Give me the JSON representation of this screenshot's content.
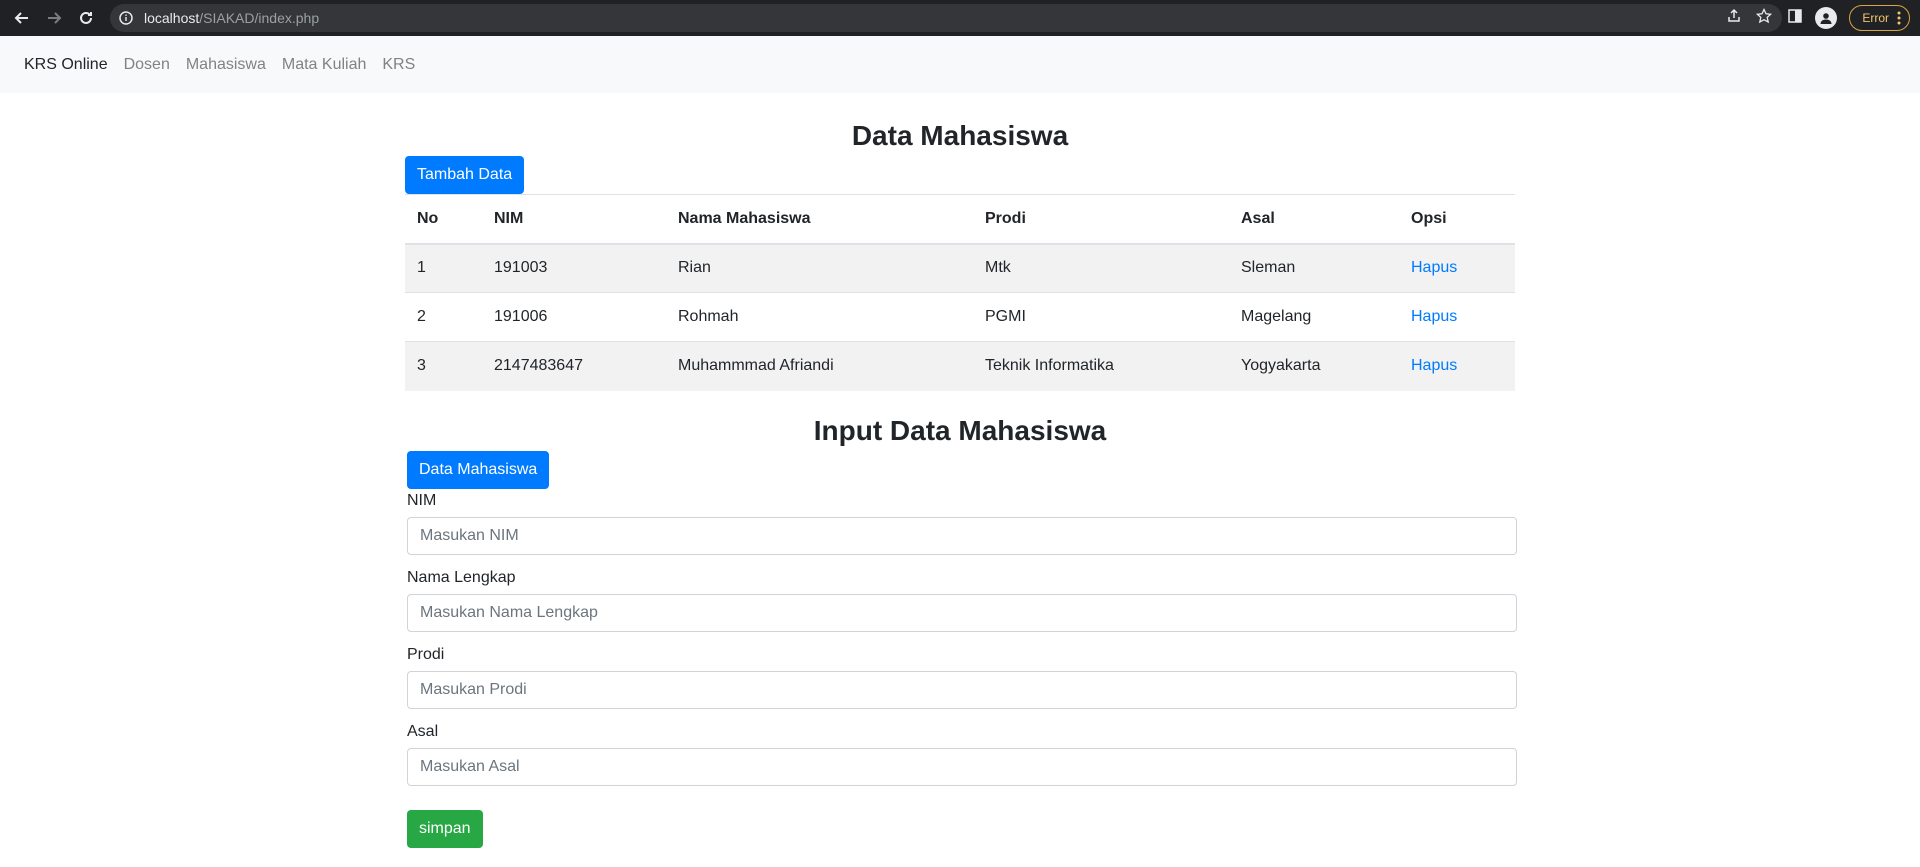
{
  "browser": {
    "url_host": "localhost",
    "url_path": "/SIAKAD/index.php",
    "error_label": "Error"
  },
  "navbar": {
    "brand": "KRS Online",
    "links": [
      "Dosen",
      "Mahasiswa",
      "Mata Kuliah",
      "KRS"
    ]
  },
  "data_section": {
    "title": "Data Mahasiswa",
    "add_button": "Tambah Data",
    "table": {
      "headers": [
        "No",
        "NIM",
        "Nama Mahasiswa",
        "Prodi",
        "Asal",
        "Opsi"
      ],
      "rows": [
        {
          "no": "1",
          "nim": "191003",
          "nama": "Rian",
          "prodi": "Mtk",
          "asal": "Sleman",
          "opsi": "Hapus"
        },
        {
          "no": "2",
          "nim": "191006",
          "nama": "Rohmah",
          "prodi": "PGMI",
          "asal": "Magelang",
          "opsi": "Hapus"
        },
        {
          "no": "3",
          "nim": "2147483647",
          "nama": "Muhammmad Afriandi",
          "prodi": "Teknik Informatika",
          "asal": "Yogyakarta",
          "opsi": "Hapus"
        }
      ]
    }
  },
  "input_section": {
    "title": "Input Data Mahasiswa",
    "data_button": "Data Mahasiswa",
    "fields": [
      {
        "label": "NIM",
        "placeholder": "Masukan NIM"
      },
      {
        "label": "Nama Lengkap",
        "placeholder": "Masukan Nama Lengkap"
      },
      {
        "label": "Prodi",
        "placeholder": "Masukan Prodi"
      },
      {
        "label": "Asal",
        "placeholder": "Masukan Asal"
      }
    ],
    "submit_button": "simpan"
  },
  "colors": {
    "primary": "#007bff",
    "success": "#28a745",
    "navbar_bg": "#f8f9fa",
    "stripe": "#f2f2f2"
  }
}
